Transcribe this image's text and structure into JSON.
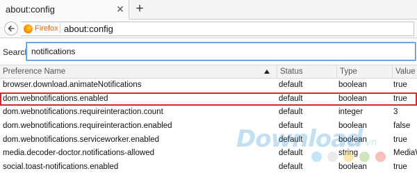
{
  "tab": {
    "title": "about:config",
    "close": "✕",
    "new_tab": "+"
  },
  "nav": {
    "identity_label": "Firefox",
    "url": "about:config"
  },
  "search": {
    "label": "Search:",
    "value": "notifications"
  },
  "table": {
    "headers": {
      "name": "Preference Name",
      "status": "Status",
      "type": "Type",
      "value": "Value"
    },
    "rows": [
      {
        "name": "browser.download.animateNotifications",
        "status": "default",
        "type": "boolean",
        "value": "true"
      },
      {
        "name": "dom.webnotifications.enabled",
        "status": "default",
        "type": "boolean",
        "value": "true"
      },
      {
        "name": "dom.webnotifications.requireinteraction.count",
        "status": "default",
        "type": "integer",
        "value": "3"
      },
      {
        "name": "dom.webnotifications.requireinteraction.enabled",
        "status": "default",
        "type": "boolean",
        "value": "false"
      },
      {
        "name": "dom.webnotifications.serviceworker.enabled",
        "status": "default",
        "type": "boolean",
        "value": "true"
      },
      {
        "name": "media.decoder-doctor.notifications-allowed",
        "status": "default",
        "type": "string",
        "value": "MediaW"
      },
      {
        "name": "social.toast-notifications.enabled",
        "status": "default",
        "type": "boolean",
        "value": "true"
      }
    ],
    "highlighted_row": 1
  },
  "watermark": {
    "text": "Download",
    "domain": ".com.vn",
    "dot_colors": [
      "#8fd0f0",
      "#d9d9d9",
      "#f5d76e",
      "#a8d08d",
      "#f28b82"
    ]
  },
  "colors": {
    "accent": "#3c8fe0",
    "highlight_border": "#d8262c",
    "firefox_orange": "#e66000"
  }
}
